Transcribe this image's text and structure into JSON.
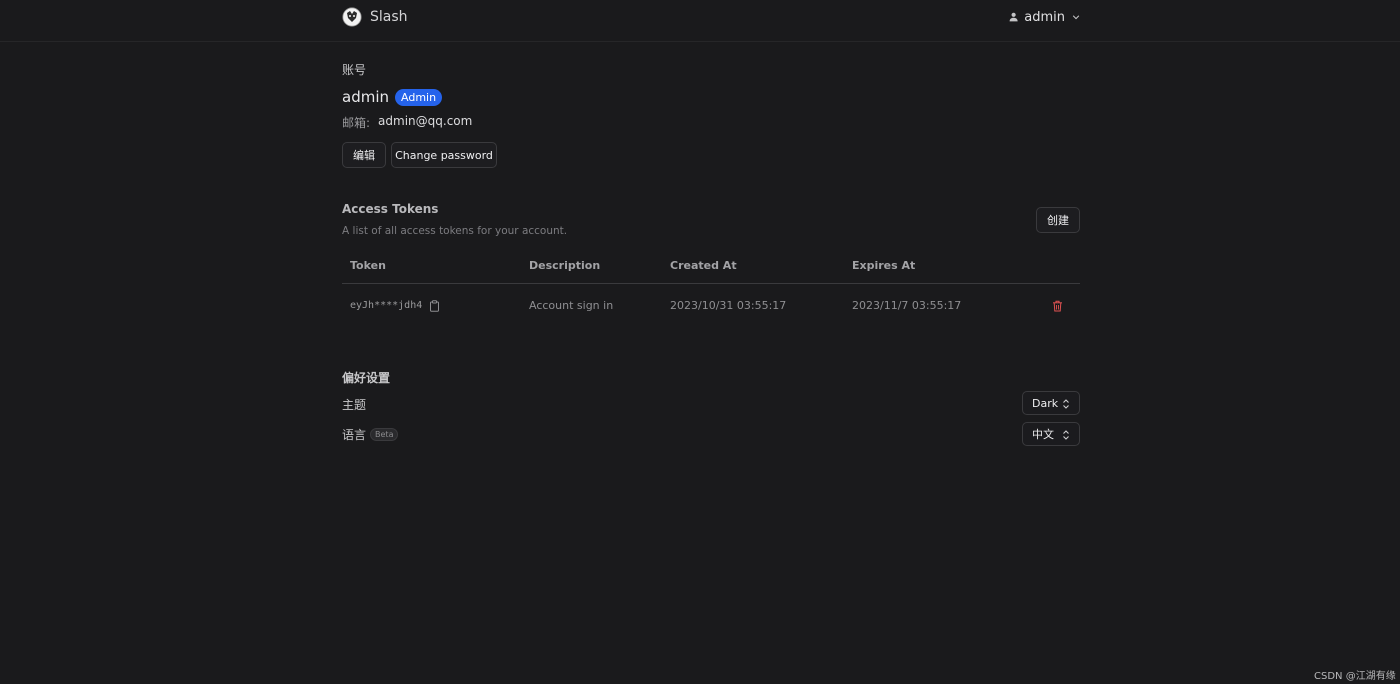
{
  "header": {
    "app_title": "Slash",
    "user_name": "admin"
  },
  "account": {
    "section_label": "账号",
    "username": "admin",
    "role_badge": "Admin",
    "email_label": "邮箱:",
    "email_value": "admin@qq.com",
    "edit_button": "编辑",
    "change_password_button": "Change password"
  },
  "access_tokens": {
    "title": "Access Tokens",
    "description": "A list of all access tokens for your account.",
    "create_button": "创建",
    "columns": [
      "Token",
      "Description",
      "Created At",
      "Expires At"
    ],
    "rows": [
      {
        "token": "eyJh****jdh4",
        "description": "Account sign in",
        "created_at": "2023/10/31 03:55:17",
        "expires_at": "2023/11/7 03:55:17"
      }
    ]
  },
  "preferences": {
    "title": "偏好设置",
    "theme_label": "主题",
    "theme_value": "Dark",
    "language_label": "语言",
    "language_beta": "Beta",
    "language_value": "中文"
  },
  "watermark": "CSDN @江湖有缘",
  "colors": {
    "background": "#1a1a1c",
    "badge": "#2563eb",
    "delete": "#e05252"
  },
  "icons": {
    "logo": "slash-logo-icon",
    "user": "user-icon",
    "dropdown": "chevron-down-icon",
    "copy": "clipboard-icon",
    "delete": "trash-icon",
    "select": "chevron-up-down-icon"
  }
}
